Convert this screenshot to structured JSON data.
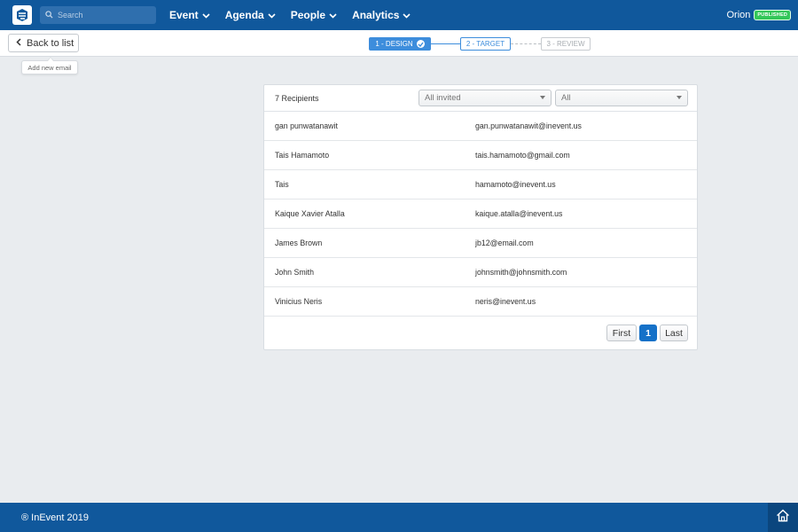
{
  "nav": {
    "search_placeholder": "Search",
    "menus": [
      {
        "label": "Event"
      },
      {
        "label": "Agenda"
      },
      {
        "label": "People"
      },
      {
        "label": "Analytics"
      }
    ],
    "user_name": "Orion",
    "status_badge": "PUBLISHED",
    "colors": {
      "brand": "#10589c",
      "accent": "#3d8ddc",
      "published": "#34c759"
    }
  },
  "subbar": {
    "back_label": "Back to list",
    "steps": [
      {
        "label": "1 - DESIGN",
        "state": "done"
      },
      {
        "label": "2 - TARGET",
        "state": "active"
      },
      {
        "label": "3 - REVIEW",
        "state": "pending"
      }
    ]
  },
  "tooltip": "Add new email",
  "recipients": {
    "count_label": "7 Recipients",
    "filter1": "All invited",
    "filter2": "All",
    "rows": [
      {
        "name": "gan punwatanawit",
        "email": "gan.punwatanawit@inevent.us"
      },
      {
        "name": "Tais Hamamoto",
        "email": "tais.hamamoto@gmail.com"
      },
      {
        "name": "Tais",
        "email": "hamamoto@inevent.us"
      },
      {
        "name": "Kaique Xavier Atalla",
        "email": "kaique.atalla@inevent.us"
      },
      {
        "name": "James Brown",
        "email": "jb12@email.com"
      },
      {
        "name": "John Smith",
        "email": "johnsmith@johnsmith.com"
      },
      {
        "name": "Vinicius Neris",
        "email": "neris@inevent.us"
      }
    ],
    "pager": {
      "first": "First",
      "current": "1",
      "last": "Last"
    }
  },
  "footer": {
    "text": "® InEvent 2019"
  }
}
